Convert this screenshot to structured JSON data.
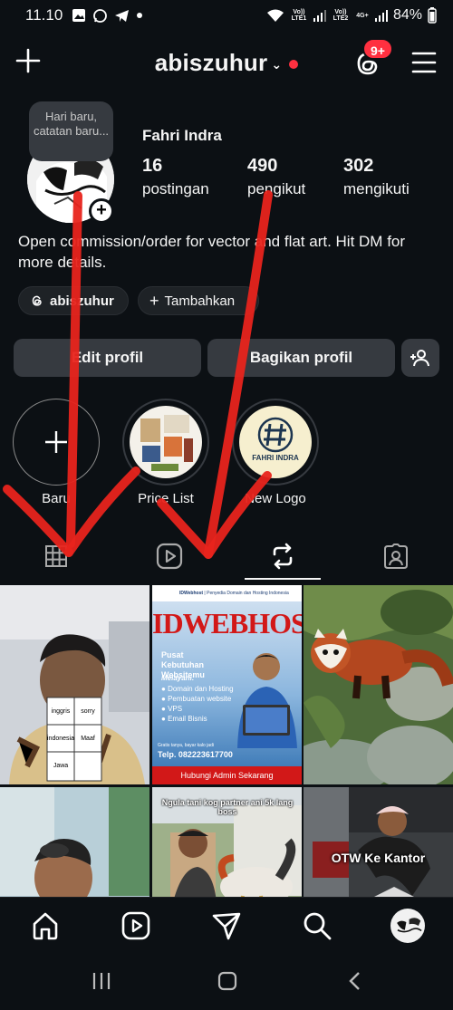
{
  "status_bar": {
    "time": "11.10",
    "battery": "84%",
    "sim1": "Vo)) LTE1",
    "sim2": "Vo)) LTE2",
    "net": "4G+",
    "icons": [
      "gallery-icon",
      "whatsapp-icon",
      "telegram-icon",
      "dot-icon",
      "wifi-icon",
      "signal-icon",
      "battery-icon"
    ]
  },
  "header": {
    "username": "abiszuhur",
    "notification_count": "9+",
    "accent": "#ff3040"
  },
  "profile": {
    "note": "Hari baru, catatan baru...",
    "full_name": "Fahri Indra",
    "stats": [
      {
        "value": "16",
        "label": "postingan"
      },
      {
        "value": "490",
        "label": "pengikut"
      },
      {
        "value": "302",
        "label": "mengikuti"
      }
    ],
    "bio": "Open commission/order for vector and flat art. Hit DM for more details.",
    "threads_chip": "abiszuhur",
    "add_chip": "Tambahkan",
    "edit_button": "Edit profil",
    "share_button": "Bagikan profil"
  },
  "highlights": [
    {
      "label": "Baru"
    },
    {
      "label": "Price List"
    },
    {
      "label": "New Logo"
    }
  ],
  "highlight_logo_text": "FAHRI INDRA",
  "tabs": [
    "grid-icon",
    "reels-icon",
    "reposts-icon",
    "tagged-icon"
  ],
  "active_tab": "reposts-icon",
  "grid_posts": {
    "p1": {
      "cells": [
        "inggris",
        "sorry",
        "indonesia",
        "Maaf",
        "Jawa",
        ""
      ]
    },
    "p2": {
      "brand": "IDWebhost",
      "tagline": "Penyedia Domain dan Hosting Indonesia",
      "title": "IDWEBHOST",
      "subtitle": "Pusat Kebutuhan Websitemu",
      "section": "Melayani:",
      "services": [
        "Domain dan Hosting",
        "Pembuatan website",
        "VPS",
        "Email Bisnis"
      ],
      "note": "Gratis tanya, bayar kalo jadi",
      "phone": "Telp. 082223617700",
      "cta": "Hubungi Admin Sekarang"
    },
    "p5": {
      "caption": "Ngula tani kog partner ani 5k lang boss"
    },
    "p6": {
      "caption": "OTW Ke Kantor"
    }
  },
  "bottom_nav": [
    "home-icon",
    "reels-icon",
    "messages-icon",
    "search-icon",
    "profile-avatar"
  ]
}
